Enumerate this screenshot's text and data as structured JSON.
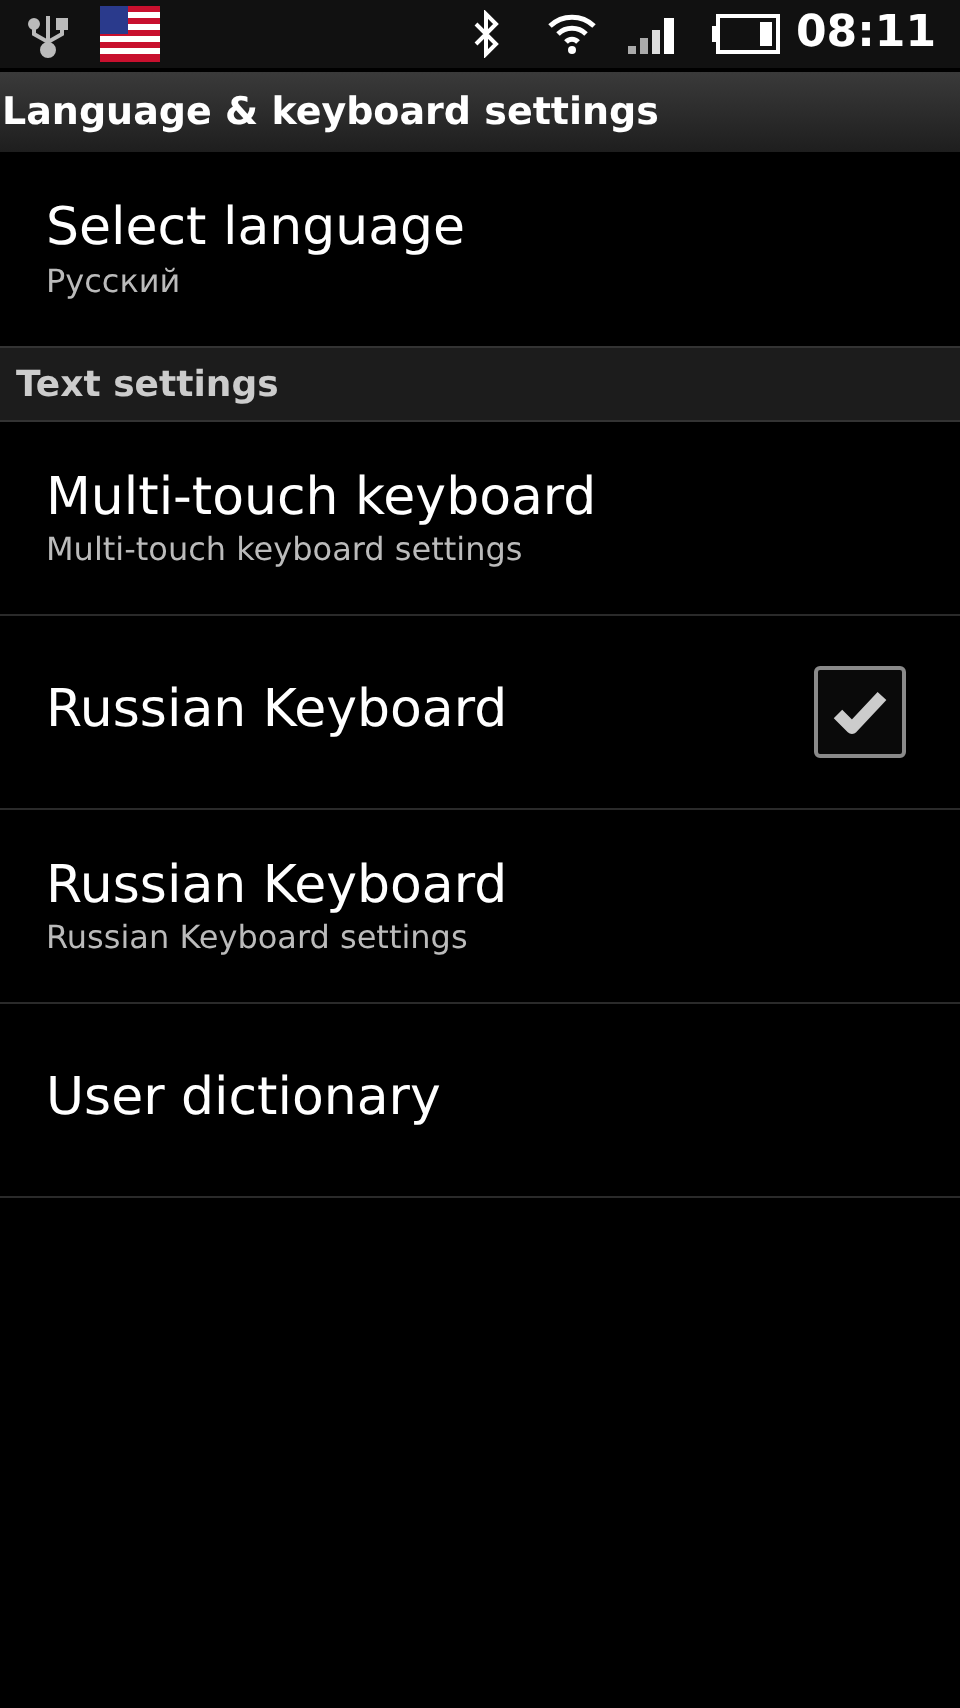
{
  "status_bar": {
    "time": "08:11"
  },
  "title": "Language & keyboard settings",
  "entries": [
    {
      "kind": "item",
      "title": "Select language",
      "summary": "Русский"
    },
    {
      "kind": "category",
      "title": "Text settings"
    },
    {
      "kind": "item",
      "title": "Multi-touch keyboard",
      "summary": "Multi-touch keyboard settings"
    },
    {
      "kind": "checkbox",
      "title": "Russian Keyboard",
      "checked": true
    },
    {
      "kind": "item",
      "title": "Russian Keyboard",
      "summary": "Russian Keyboard settings"
    },
    {
      "kind": "item",
      "title": "User dictionary"
    }
  ]
}
